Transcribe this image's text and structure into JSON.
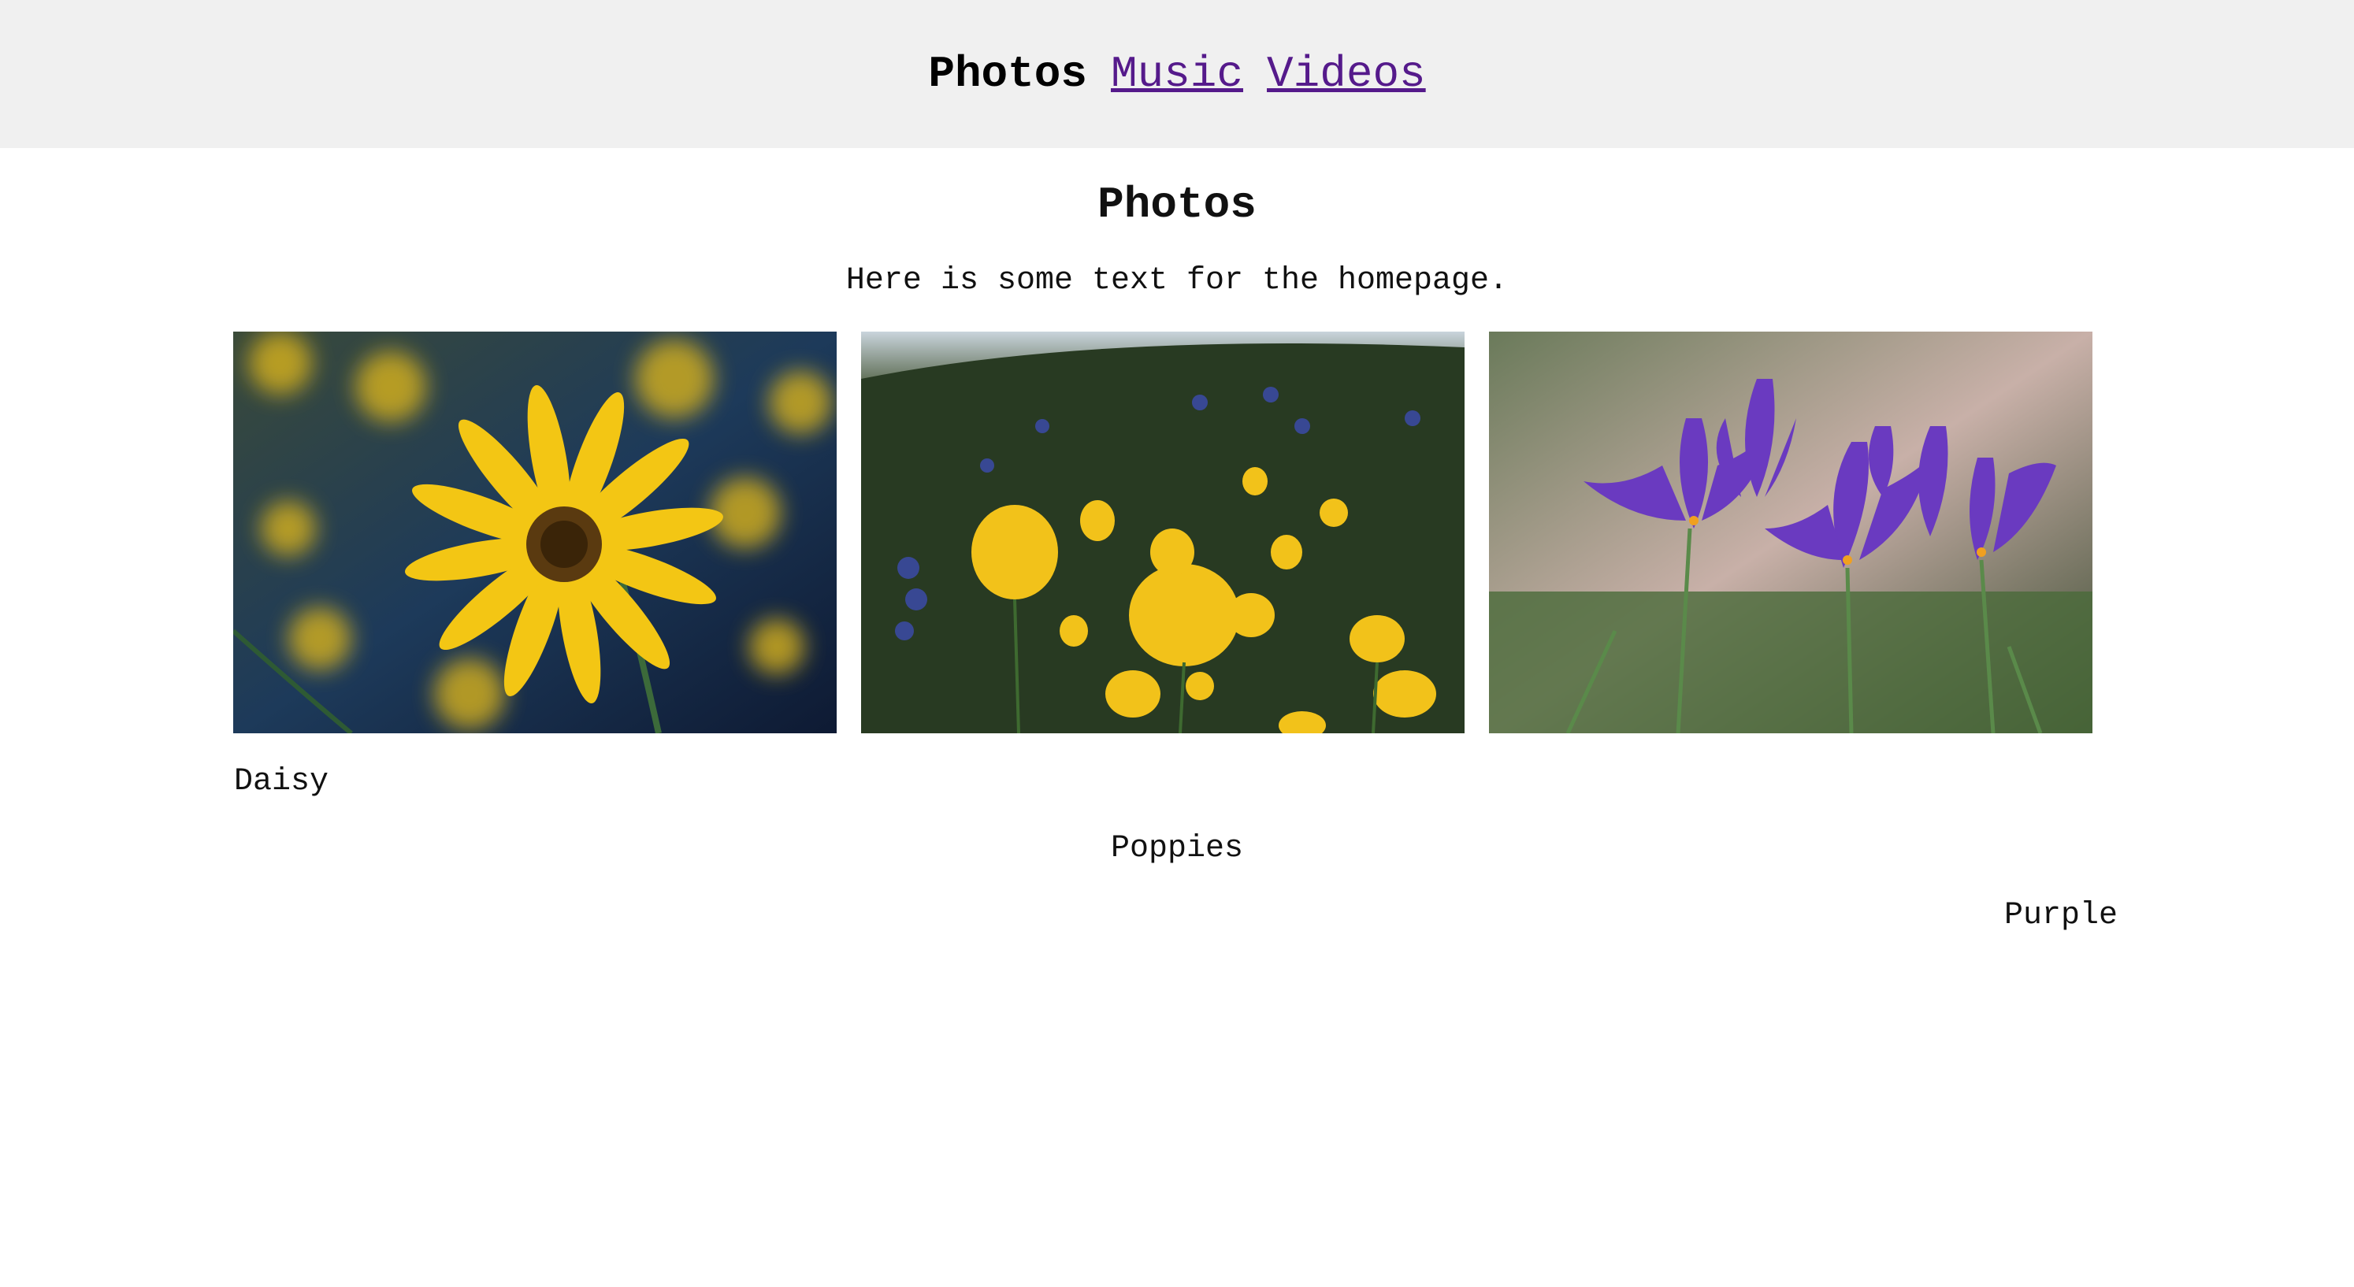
{
  "nav": {
    "current": "Photos",
    "links": [
      "Music",
      "Videos"
    ]
  },
  "main": {
    "title": "Photos",
    "intro": "Here is some text for the homepage."
  },
  "gallery": [
    {
      "caption": "Daisy",
      "image": "yellow-daisy-photo"
    },
    {
      "caption": "Poppies",
      "image": "yellow-poppies-photo"
    },
    {
      "caption": "Purple",
      "image": "purple-crocus-photo"
    }
  ],
  "colors": {
    "nav_bg": "#f0f0f0",
    "link": "#551a8b"
  }
}
